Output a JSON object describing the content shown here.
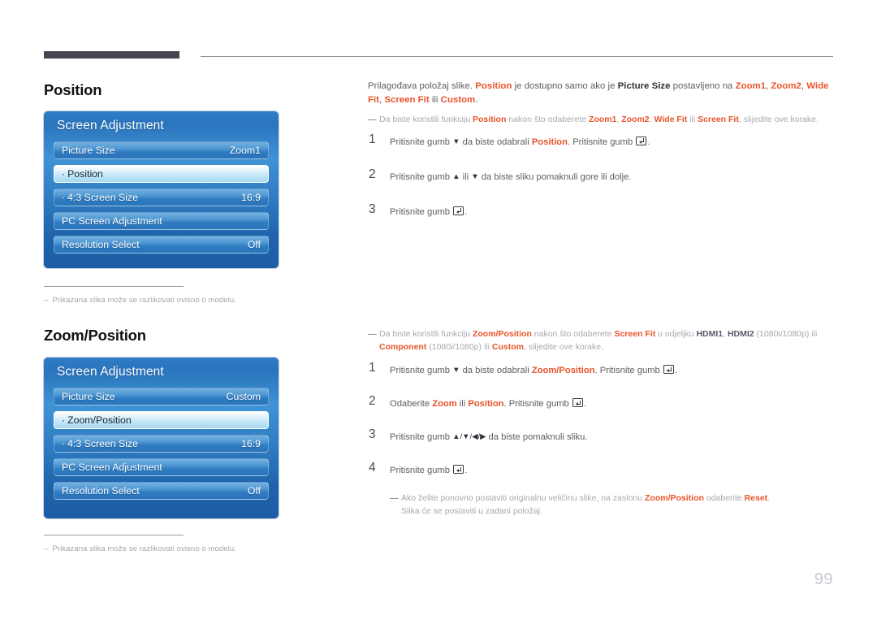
{
  "page": {
    "number": "99"
  },
  "sections": [
    {
      "heading": "Position",
      "osd": {
        "title": "Screen Adjustment",
        "rows": [
          {
            "label": "Picture Size",
            "value": "Zoom1",
            "bullet": "",
            "selected": false
          },
          {
            "label": "Position",
            "value": "",
            "bullet": "·",
            "selected": true
          },
          {
            "label": "4:3 Screen Size",
            "value": "16:9",
            "bullet": "·",
            "selected": false
          },
          {
            "label": "PC Screen Adjustment",
            "value": "",
            "bullet": "",
            "selected": false
          },
          {
            "label": "Resolution Select",
            "value": "Off",
            "bullet": "",
            "selected": false
          }
        ]
      },
      "note": {
        "dash": "–",
        "text": "Prikazana slika može se razlikovati ovisno o modelu."
      }
    },
    {
      "heading": "Zoom/Position",
      "osd": {
        "title": "Screen Adjustment",
        "rows": [
          {
            "label": "Picture Size",
            "value": "Custom",
            "bullet": "",
            "selected": false
          },
          {
            "label": "Zoom/Position",
            "value": "",
            "bullet": "·",
            "selected": true
          },
          {
            "label": "4:3 Screen Size",
            "value": "16:9",
            "bullet": "·",
            "selected": false
          },
          {
            "label": "PC Screen Adjustment",
            "value": "",
            "bullet": "",
            "selected": false
          },
          {
            "label": "Resolution Select",
            "value": "Off",
            "bullet": "",
            "selected": false
          }
        ]
      },
      "note": {
        "dash": "–",
        "text": "Prikazana slika može se razlikovati ovisno o modelu."
      }
    }
  ],
  "body": {
    "intro": {
      "t1": "Prilagođava položaj slike. ",
      "k1": "Position",
      "t2": " je dostupno samo ako je ",
      "k2": "Picture Size",
      "t3": " postavljeno na ",
      "k3": "Zoom1",
      "t4": ", ",
      "k4": "Zoom2",
      "t5": ", ",
      "k5": "Wide Fit",
      "t6": ", ",
      "k6": "Screen Fit",
      "t7": " ili ",
      "k7": "Custom",
      "t8": "."
    },
    "tip1": {
      "emdash": "—",
      "t1": "Da biste koristili funkciju ",
      "k1": "Position",
      "t2": " nakon što odaberete ",
      "k2": "Zoom1",
      "t3": ", ",
      "k3": "Zoom2",
      "t4": ", ",
      "k4": "Wide Fit",
      "t5": " ili ",
      "k5": "Screen Fit",
      "t6": ", slijedite ove korake."
    },
    "steps1": [
      {
        "num": "1",
        "t1": "Pritisnite gumb ",
        "arrow1": "▼",
        "t2": " da biste odabrali ",
        "k1": "Position",
        "t3": ". Pritisnite gumb ",
        "t4": "."
      },
      {
        "num": "2",
        "t1": "Pritisnite gumb ",
        "arrow1": "▲",
        "t2": " ili ",
        "arrow2": "▼",
        "t3": " da biste sliku pomaknuli gore ili dolje."
      },
      {
        "num": "3",
        "t1": "Pritisnite gumb ",
        "t2": "."
      }
    ],
    "tip2": {
      "emdash": "—",
      "t1": "Da biste koristili funkciju ",
      "k1": "Zoom/Position",
      "t2": " nakon što odaberete ",
      "k2": "Screen Fit",
      "t3": " u odjeljku ",
      "k3": "HDMI1",
      "t4": ", ",
      "k4": "HDMI2",
      "t5": " (1080i/1080p) ili ",
      "k5": "Component",
      "t6": " (1080i/1080p) ili ",
      "k6": "Custom",
      "t7": ", slijedite ove korake."
    },
    "steps2": [
      {
        "num": "1",
        "t1": "Pritisnite gumb ",
        "arrow1": "▼",
        "t2": " da biste odabrali ",
        "k1": "Zoom/Position",
        "t3": ". Pritisnite gumb ",
        "t4": "."
      },
      {
        "num": "2",
        "t1": "Odaberite ",
        "k1": "Zoom",
        "t2": " ili ",
        "k2": "Position",
        "t3": ". Pritisnite gumb ",
        "t4": "."
      },
      {
        "num": "3",
        "t1": "Pritisnite gumb ",
        "arrows": "▲/▼/◀/▶",
        "t2": " da biste pomaknuli sliku."
      },
      {
        "num": "4",
        "t1": "Pritisnite gumb ",
        "t2": "."
      }
    ],
    "tip3": {
      "emdash": "—",
      "t1": "Ako želite ponovno postaviti originalnu veličinu slike, na zaslonu ",
      "k1": "Zoom/Position",
      "t2": " odaberite ",
      "k2": "Reset",
      "t3": ".",
      "t4": "Slika će se postaviti u zadani položaj."
    }
  }
}
